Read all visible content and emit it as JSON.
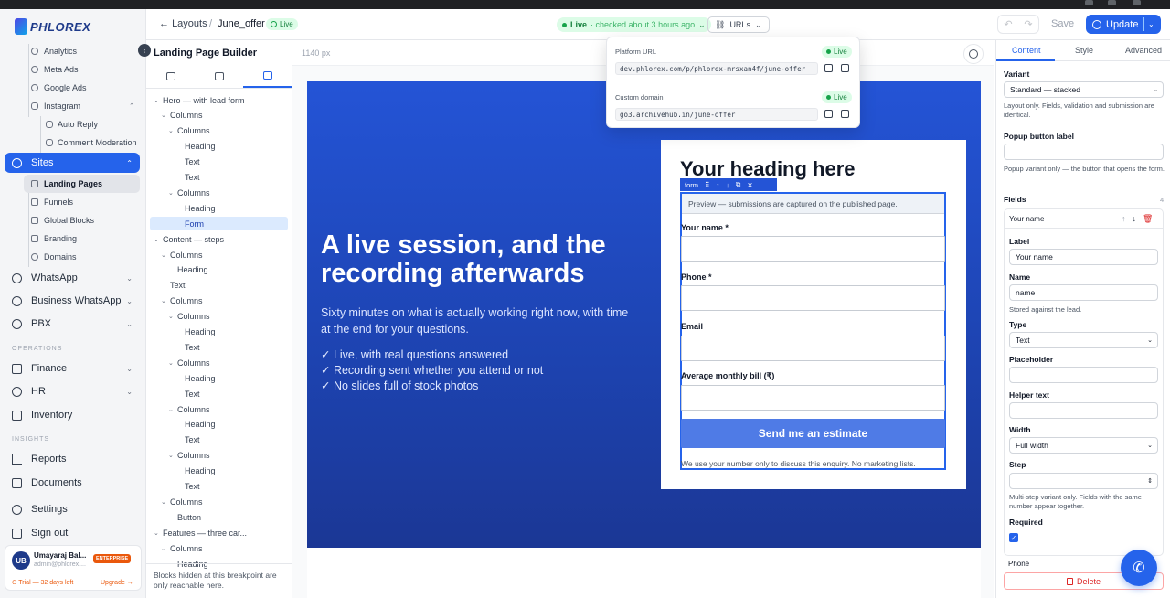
{
  "brand": {
    "logo_text": "PHLOREX"
  },
  "sidebar": {
    "subitems_top": [
      {
        "label": "Analytics",
        "icon": "analytics-icon"
      },
      {
        "label": "Meta Ads",
        "icon": "meta-icon"
      },
      {
        "label": "Google Ads",
        "icon": "google-icon"
      },
      {
        "label": "Instagram",
        "icon": "instagram-icon"
      }
    ],
    "instagram_children": [
      "Auto Reply",
      "Comment Moderation"
    ],
    "sites_label": "Sites",
    "sites_children": [
      "Landing Pages",
      "Funnels",
      "Global Blocks",
      "Branding",
      "Domains"
    ],
    "main_items": [
      "WhatsApp",
      "Business WhatsApp",
      "PBX"
    ],
    "section_operations": "OPERATIONS",
    "operations_items": [
      "Finance",
      "HR",
      "Inventory"
    ],
    "section_insights": "INSIGHTS",
    "insights_items": [
      "Reports",
      "Documents"
    ],
    "settings_label": "Settings",
    "signout_label": "Sign out",
    "user": {
      "initials": "UB",
      "name": "Umayaraj Bal...",
      "email": "admin@phlorex....",
      "badge": "ENTERPRISE"
    },
    "trial_text": "⏲ Trial — 32 days left",
    "upgrade_text": "Upgrade →"
  },
  "topbar": {
    "back_label": "Layouts",
    "separator": "/",
    "page_name": "June_offer",
    "live_label": "Live",
    "status_live": "Live",
    "status_sub": "· checked about 3 hours ago",
    "urls_label": "URLs",
    "save_label": "Save",
    "update_label": "Update"
  },
  "url_popover": {
    "platform_label": "Platform URL",
    "platform_status": "Live",
    "platform_url": "dev.phlorex.com/p/phlorex-mrsxan4f/june-offer",
    "custom_label": "Custom domain",
    "custom_status": "Live",
    "custom_url": "go3.archivehub.in/june-offer"
  },
  "builder": {
    "title": "Landing Page Builder",
    "tree": [
      {
        "label": "Hero — with lead form",
        "depth": 0,
        "caret": true
      },
      {
        "label": "Columns",
        "depth": 1,
        "caret": true
      },
      {
        "label": "Columns",
        "depth": 2,
        "caret": true
      },
      {
        "label": "Heading",
        "depth": 3
      },
      {
        "label": "Text",
        "depth": 3
      },
      {
        "label": "Text",
        "depth": 3
      },
      {
        "label": "Columns",
        "depth": 2,
        "caret": true
      },
      {
        "label": "Heading",
        "depth": 3
      },
      {
        "label": "Form",
        "depth": 3,
        "selected": true
      },
      {
        "label": "Content — steps",
        "depth": 0,
        "caret": true
      },
      {
        "label": "Columns",
        "depth": 1,
        "caret": true
      },
      {
        "label": "Heading",
        "depth": 2
      },
      {
        "label": "Text",
        "depth": 1
      },
      {
        "label": "Columns",
        "depth": 1,
        "caret": true
      },
      {
        "label": "Columns",
        "depth": 2,
        "caret": true
      },
      {
        "label": "Heading",
        "depth": 3
      },
      {
        "label": "Text",
        "depth": 3
      },
      {
        "label": "Columns",
        "depth": 2,
        "caret": true
      },
      {
        "label": "Heading",
        "depth": 3
      },
      {
        "label": "Text",
        "depth": 3
      },
      {
        "label": "Columns",
        "depth": 2,
        "caret": true
      },
      {
        "label": "Heading",
        "depth": 3
      },
      {
        "label": "Text",
        "depth": 3
      },
      {
        "label": "Columns",
        "depth": 2,
        "caret": true
      },
      {
        "label": "Heading",
        "depth": 3
      },
      {
        "label": "Text",
        "depth": 3
      },
      {
        "label": "Columns",
        "depth": 1,
        "caret": true
      },
      {
        "label": "Button",
        "depth": 2
      },
      {
        "label": "Features — three car...",
        "depth": 0,
        "caret": true
      },
      {
        "label": "Columns",
        "depth": 1,
        "caret": true
      },
      {
        "label": "Heading",
        "depth": 2
      }
    ],
    "footer_note": "Blocks hidden at this breakpoint are only reachable here."
  },
  "canvas": {
    "width_label": "1140 px",
    "hero_heading": "A live session, and the recording afterwards",
    "hero_paragraph": "Sixty minutes on what is actually working right now, with time at the end for your questions.",
    "checks": [
      "✓ Live, with real questions answered",
      "✓ Recording sent whether you attend or not",
      "✓ No slides full of stock photos"
    ],
    "form_heading": "Your heading here",
    "form_toolbar_label": "form",
    "preview_text": "Preview — submissions are captured on the published page.",
    "fields": [
      "Your name *",
      "Phone *",
      "Email",
      "Average monthly bill (₹)"
    ],
    "submit_label": "Send me an estimate",
    "form_footer": "We use your number only to discuss this enquiry. No marketing lists."
  },
  "inspector": {
    "tabs": [
      "Content",
      "Style",
      "Advanced"
    ],
    "variant_label": "Variant",
    "variant_value": "Standard — stacked",
    "variant_help": "Layout only. Fields, validation and submission are identical.",
    "popup_label": "Popup button label",
    "popup_help": "Popup variant only — the button that opens the form.",
    "fields_label": "Fields",
    "fields_count": "4",
    "field_card": {
      "title": "Your name",
      "label_label": "Label",
      "label_value": "Your name",
      "name_label": "Name",
      "name_value": "name",
      "name_help": "Stored against the lead.",
      "type_label": "Type",
      "type_value": "Text",
      "placeholder_label": "Placeholder",
      "helper_label": "Helper text",
      "width_label": "Width",
      "width_value": "Full width",
      "step_label": "Step",
      "step_help": "Multi-step variant only. Fields with the same number appear together.",
      "required_label": "Required"
    },
    "next_field": "Phone",
    "delete_label": "Delete"
  }
}
